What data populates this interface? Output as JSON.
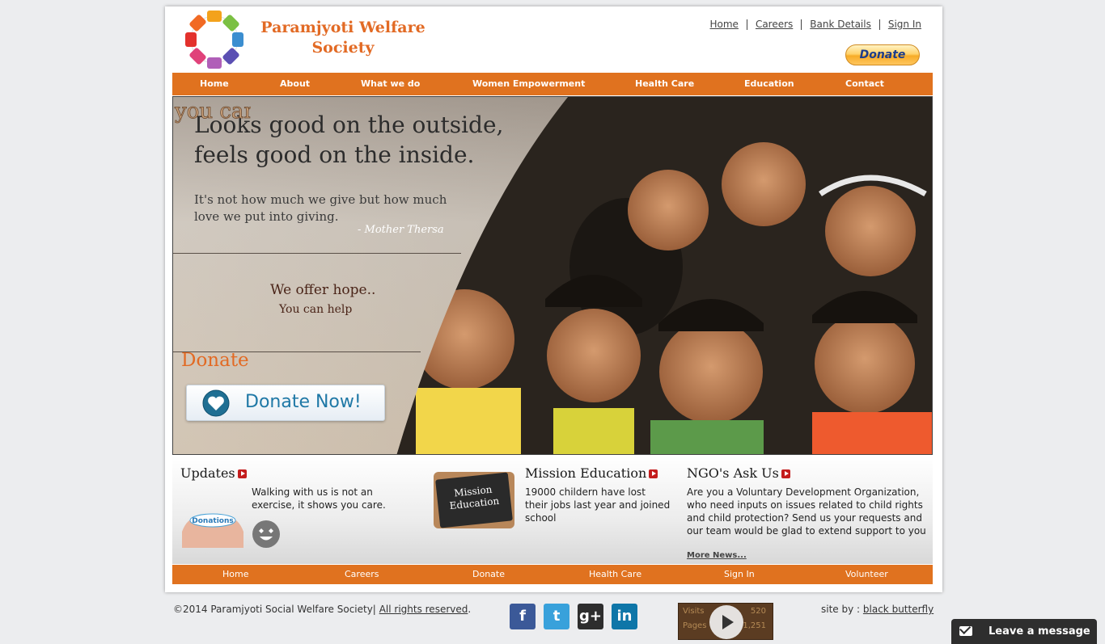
{
  "header": {
    "brand_line1": "Paramjyoti Welfare",
    "brand_line2": "Society",
    "top_links": [
      "Home",
      "Careers",
      "Bank Details",
      "Sign In"
    ],
    "paypal_label": "Donate"
  },
  "nav": [
    "Home",
    "About",
    "What we do",
    "Women Empowerment",
    "Health Care",
    "Education",
    "Contact"
  ],
  "hero": {
    "title_line1": "Looks good on the outside,",
    "title_line2": "feels good on the inside.",
    "quote_line1": "It's not how much we give but how much",
    "quote_line2": "love we put into giving.",
    "author": "- Mother Thersa",
    "you_can_help_image_text": "you can help",
    "hope_line1": "We offer hope..",
    "hope_line2": "You can help",
    "donate_heading": "Donate",
    "donate_button": "Donate Now!"
  },
  "updates": {
    "title": "Updates",
    "text_line1": "Walking with us is not an",
    "text_line2": "exercise, it shows you care.",
    "image_text": "Donations"
  },
  "mission": {
    "title": "Mission Education",
    "board_line1": "Mission",
    "board_line2": "Education",
    "text_line1": "19000 childern have lost",
    "text_line2": "their jobs last year and joined",
    "text_line3": "school"
  },
  "ngo": {
    "title": "NGO's Ask Us",
    "text_line1": "Are you a Voluntary Development Organization,",
    "text_line2": "who need inputs on issues related to child rights",
    "text_line3": "and child protection? Send us your requests and",
    "text_line4": "our team would be glad to extend support to you",
    "more": "More News..."
  },
  "footer_nav": [
    "Home",
    "Careers",
    "Donate",
    "Health Care",
    "Sign In",
    "Volunteer"
  ],
  "footer": {
    "copyright": "©2014 Paramjyoti Social Welfare Society|",
    "rights": "All rights reserved",
    "rights_suffix": ".",
    "siteby_label": "site by :",
    "siteby_link": "black butterfly",
    "counter_visits_label": "Visits",
    "counter_visits": "520",
    "counter_pages_label": "Pages",
    "counter_pages": "1,251",
    "chat": "Leave a message"
  },
  "social": [
    {
      "name": "facebook",
      "glyph": "f",
      "color": "#3b5998"
    },
    {
      "name": "twitter",
      "glyph": "t",
      "color": "#38a1db"
    },
    {
      "name": "google-plus",
      "glyph": "g+",
      "color": "#2d2d2d"
    },
    {
      "name": "linkedin",
      "glyph": "in",
      "color": "#0e76a8"
    }
  ],
  "colors": {
    "accent": "#e0721f",
    "brand_text": "#e26a24"
  }
}
